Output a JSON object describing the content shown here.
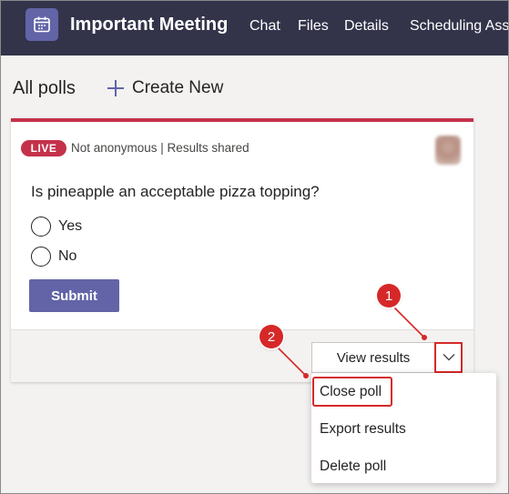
{
  "header": {
    "title": "Important Meeting",
    "tabs": [
      "Chat",
      "Files",
      "Details",
      "Scheduling Assi"
    ],
    "app_icon": "calendar-icon",
    "background": "#33344a"
  },
  "toolbar": {
    "all_polls": "All polls",
    "create_new": "Create New"
  },
  "poll": {
    "status": "LIVE",
    "meta": "Not anonymous | Results shared",
    "question": "Is pineapple an acceptable pizza topping?",
    "options": [
      "Yes",
      "No"
    ],
    "submit_label": "Submit",
    "view_results_label": "View results",
    "accent": "#c4314b",
    "button_color": "#6264a7"
  },
  "menu": {
    "items": [
      "Close poll",
      "Export results",
      "Delete poll"
    ]
  },
  "annotations": {
    "callout_1": "1",
    "callout_2": "2",
    "highlight_color": "#d62828"
  }
}
